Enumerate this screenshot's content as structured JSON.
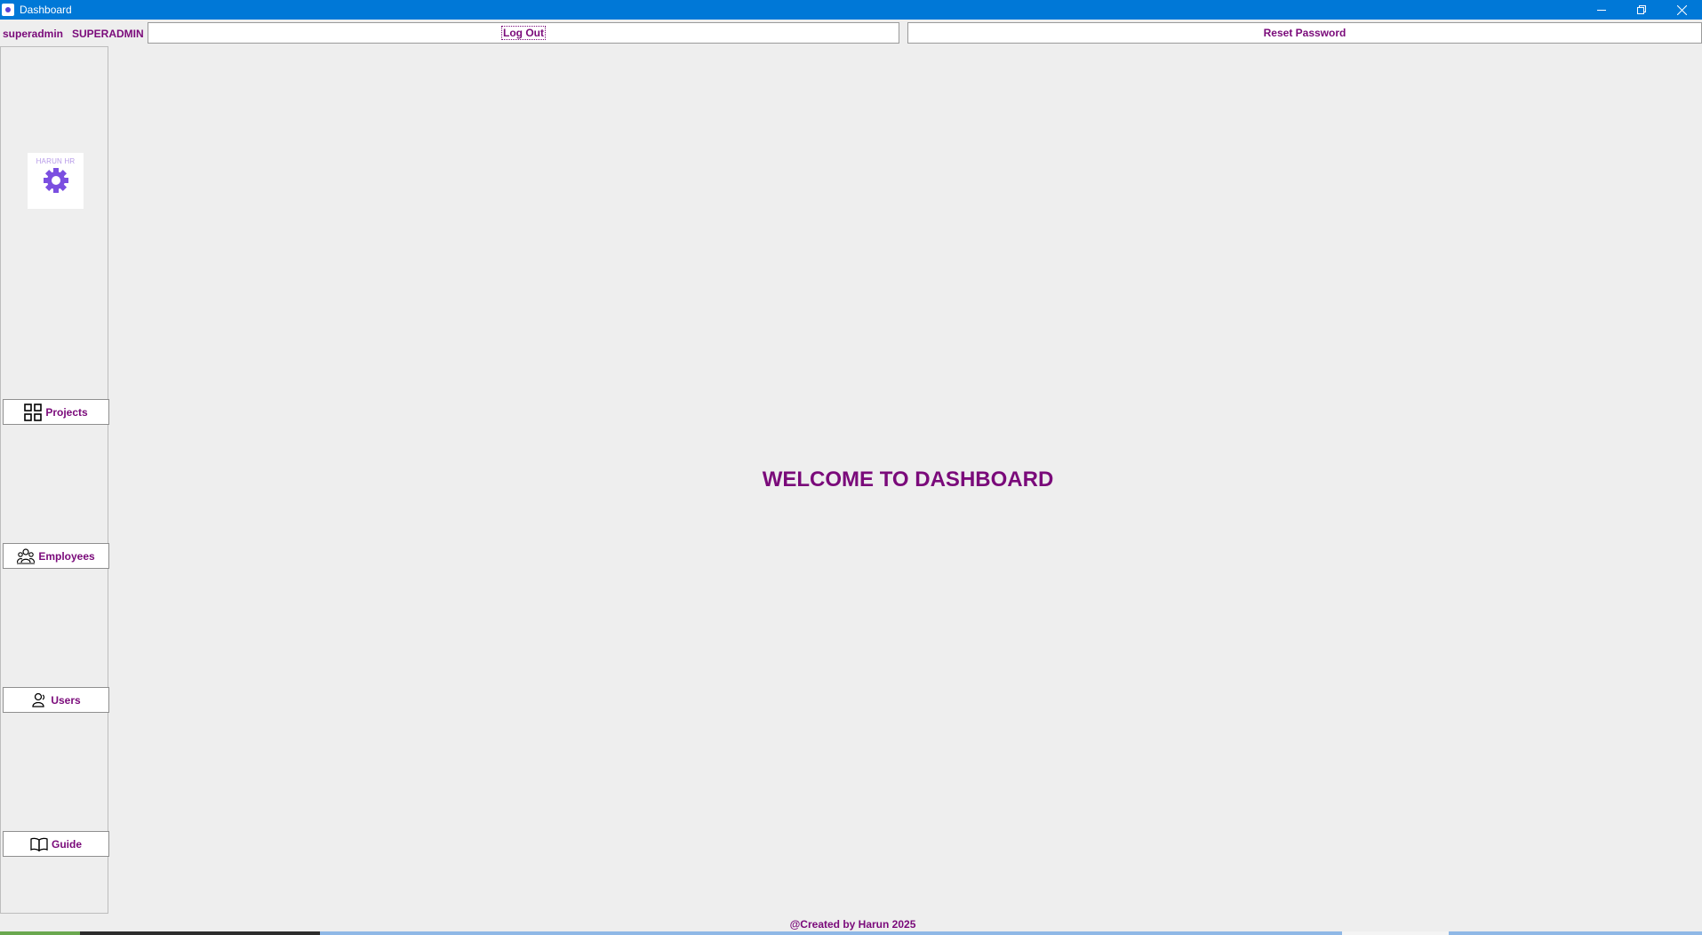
{
  "window": {
    "title": "Dashboard",
    "icon": "app-gear-icon",
    "controls": [
      "minimize-icon",
      "restore-icon",
      "close-icon"
    ]
  },
  "header": {
    "username": "superadmin",
    "role": "SUPERADMIN",
    "logout_label": "Log Out",
    "reset_password_label": "Reset Password"
  },
  "sidebar": {
    "logo_text": "HARUN HR",
    "items": [
      {
        "label": "Projects",
        "icon": "grid-icon"
      },
      {
        "label": "Employees",
        "icon": "employees-icon"
      },
      {
        "label": "Users",
        "icon": "user-icon"
      },
      {
        "label": "Guide",
        "icon": "book-icon"
      }
    ]
  },
  "main": {
    "welcome_text": "WELCOME TO DASHBOARD"
  },
  "footer": {
    "text": "@Created by Harun 2025"
  },
  "colors": {
    "titlebar": "#0078d7",
    "accent_text": "#7a0a7a",
    "background": "#eeeeee",
    "logo_gear": "#7b4fe0"
  }
}
